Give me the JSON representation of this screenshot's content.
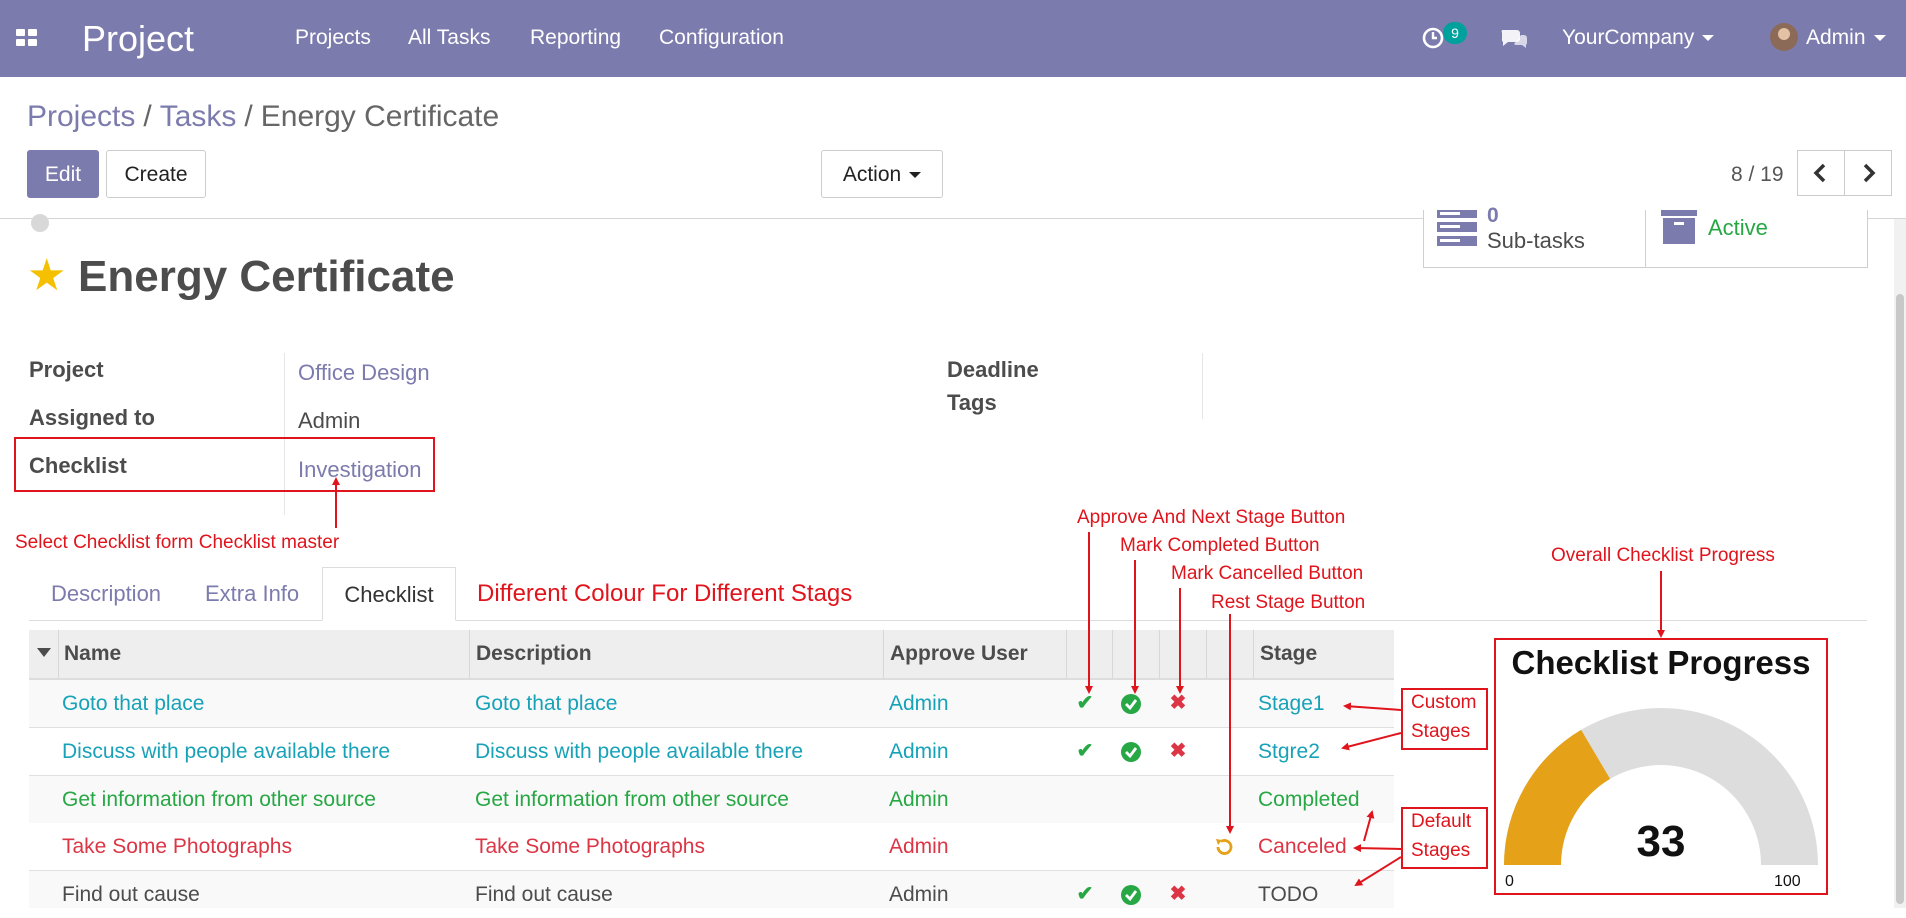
{
  "colors": {
    "navbar": "#7c7bad",
    "link": "#7c7bad",
    "stage_teal": "#17a2b8",
    "completed_green": "#28a745",
    "canceled_red": "#dc3545",
    "gauge_fill": "#e5a118",
    "annotation_red": "#e0141c"
  },
  "navbar": {
    "brand": "Project",
    "menu": [
      "Projects",
      "All Tasks",
      "Reporting",
      "Configuration"
    ],
    "activity_count": "9",
    "company": "YourCompany",
    "user": "Admin",
    "icons": [
      "apps-grid-icon",
      "activity-clock-icon",
      "chat-bubbles-icon",
      "avatar"
    ]
  },
  "breadcrumb": {
    "items": [
      "Projects",
      "Tasks"
    ],
    "current": "Energy Certificate",
    "separator": "/"
  },
  "buttons": {
    "edit": "Edit",
    "create": "Create",
    "action": "Action"
  },
  "pager": {
    "value": "8 / 19"
  },
  "smart_buttons": {
    "subtasks_count": "0",
    "subtasks_label": "Sub-tasks",
    "status_label": "Active"
  },
  "form": {
    "title": "Energy Certificate",
    "fields": {
      "project_label": "Project",
      "project_value": "Office Design",
      "assigned_label": "Assigned to",
      "assigned_value": "Admin",
      "checklist_label": "Checklist",
      "checklist_value": "Investigation",
      "deadline_label": "Deadline",
      "tags_label": "Tags"
    }
  },
  "tabs": [
    "Description",
    "Extra Info",
    "Checklist"
  ],
  "active_tab": "Checklist",
  "table": {
    "columns": [
      "Name",
      "Description",
      "Approve User",
      "Stage"
    ],
    "rows": [
      {
        "name": "Goto that place",
        "description": "Goto that place",
        "user": "Admin",
        "stage": "Stage1",
        "color": "teal",
        "actions": [
          "approve",
          "complete",
          "cancel"
        ]
      },
      {
        "name": "Discuss with people available there",
        "description": "Discuss with people available there",
        "user": "Admin",
        "stage": "Stgre2",
        "color": "teal",
        "actions": [
          "approve",
          "complete",
          "cancel"
        ]
      },
      {
        "name": "Get information from other source",
        "description": "Get information from other source",
        "user": "Admin",
        "stage": "Completed",
        "color": "green",
        "actions": []
      },
      {
        "name": "Take Some Photographs",
        "description": "Take Some Photographs",
        "user": "Admin",
        "stage": "Canceled",
        "color": "red",
        "actions": [
          "reset"
        ]
      },
      {
        "name": "Find out cause",
        "description": "Find out cause",
        "user": "Admin",
        "stage": "TODO",
        "color": "default",
        "actions": [
          "approve",
          "complete",
          "cancel"
        ]
      }
    ]
  },
  "gauge": {
    "title": "Checklist Progress",
    "value": 33,
    "min": 0,
    "max": 100,
    "value_label": "33",
    "min_label": "0",
    "max_label": "100"
  },
  "annotations": {
    "select_checklist": "Select Checklist form Checklist master",
    "different_colour": "Different Colour For Different Stags",
    "approve_next": "Approve And Next Stage Button",
    "mark_completed": "Mark Completed Button",
    "mark_cancelled": "Mark Cancelled Button",
    "rest_stage": "Rest Stage Button",
    "overall_progress": "Overall Checklist Progress",
    "custom_1": "Custom",
    "custom_2": "Stages",
    "default_1": "Default",
    "default_2": "Stages"
  }
}
